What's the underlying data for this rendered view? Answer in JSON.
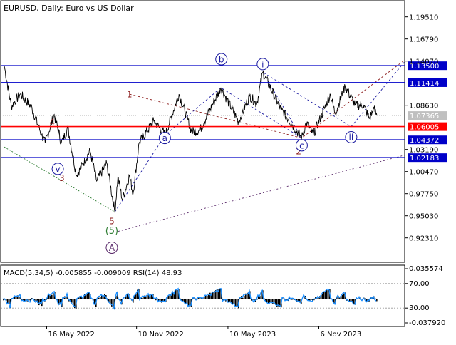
{
  "header": {
    "symbol_title": "EURUSD, Daily:  Euro vs US Dollar"
  },
  "indicator": {
    "title": "MACD(5,34,5) -0.005855 -0.009009 RSI(14) 48.93",
    "axis_labels": [
      "0.035574",
      "70.00",
      "30.00",
      "-0.037920"
    ]
  },
  "colors": {
    "level_blue": "#0000c8",
    "level_red": "#ff0000",
    "price_line": "#000000",
    "wave_red": "#8b1a1a",
    "wave_blue": "#1a1aa0",
    "wave_green": "#2e7d32",
    "wave_purple": "#5a2a6a",
    "rsi_line": "#1e90ff",
    "current_price_tag": "#c0c0c0"
  },
  "price_axis_labels": [
    "1.19510",
    "1.16790",
    "1.14070",
    "1.08630",
    "1.03190",
    "1.00470",
    "0.97750",
    "0.95030",
    "0.92310"
  ],
  "level_tags": [
    {
      "value": 1.135,
      "label": "1.13500",
      "type": "blue"
    },
    {
      "value": 1.11414,
      "label": "1.11414",
      "type": "blue"
    },
    {
      "value": 1.07365,
      "label": "1.07365",
      "type": "current"
    },
    {
      "value": 1.06005,
      "label": "1.06005",
      "type": "red"
    },
    {
      "value": 1.04372,
      "label": "1.04372",
      "type": "blue"
    },
    {
      "value": 1.02183,
      "label": "1.02183",
      "type": "blue"
    }
  ],
  "time_axis_labels": [
    "16 May 2022",
    "10 Nov 2022",
    "10 May 2023",
    "6 Nov 2023"
  ],
  "wave_labels": [
    {
      "text": "1",
      "style": "red-plain",
      "date": "2022-10-27",
      "price": 1.1
    },
    {
      "text": "2",
      "style": "red-plain",
      "date": "2023-09-27",
      "price": 1.03
    },
    {
      "text": "3",
      "style": "red-plain",
      "date": "2022-06-15",
      "price": 0.997
    },
    {
      "text": "4",
      "style": "red-plain",
      "date": "2022-05-27",
      "price": 1.066
    },
    {
      "text": "5",
      "style": "red-plain",
      "date": "2022-09-22",
      "price": 0.944
    },
    {
      "text": "(5)",
      "style": "green",
      "date": "2022-09-22",
      "price": 0.932
    },
    {
      "text": "A",
      "style": "purple-circle",
      "date": "2022-09-22",
      "price": 0.911
    },
    {
      "text": "a",
      "style": "blue-circle",
      "date": "2023-01-05",
      "price": 1.046
    },
    {
      "text": "b",
      "style": "blue-circle",
      "date": "2023-04-27",
      "price": 1.143
    },
    {
      "text": "c",
      "style": "blue-circle",
      "date": "2023-10-03",
      "price": 1.037
    },
    {
      "text": "v",
      "style": "blue-circle",
      "date": "2022-06-07",
      "price": 1.008
    },
    {
      "text": "i",
      "style": "blue-circle",
      "date": "2023-07-18",
      "price": 1.137
    },
    {
      "text": "ii",
      "style": "blue-circle",
      "date": "2024-01-09",
      "price": 1.047
    }
  ],
  "chart_data": {
    "type": "line",
    "symbol": "EURUSD",
    "timeframe": "Daily",
    "x_axis": "date",
    "price_series": [
      {
        "date": "2022-02-21",
        "price": 1.135
      },
      {
        "date": "2022-03-07",
        "price": 1.085
      },
      {
        "date": "2022-03-25",
        "price": 1.1
      },
      {
        "date": "2022-04-15",
        "price": 1.085
      },
      {
        "date": "2022-05-06",
        "price": 1.05
      },
      {
        "date": "2022-05-13",
        "price": 1.04
      },
      {
        "date": "2022-05-31",
        "price": 1.075
      },
      {
        "date": "2022-06-14",
        "price": 1.04
      },
      {
        "date": "2022-06-27",
        "price": 1.058
      },
      {
        "date": "2022-07-14",
        "price": 1.0
      },
      {
        "date": "2022-08-10",
        "price": 1.03
      },
      {
        "date": "2022-08-23",
        "price": 0.993
      },
      {
        "date": "2022-09-12",
        "price": 1.015
      },
      {
        "date": "2022-09-28",
        "price": 0.955
      },
      {
        "date": "2022-10-04",
        "price": 0.998
      },
      {
        "date": "2022-10-13",
        "price": 0.97
      },
      {
        "date": "2022-10-27",
        "price": 1.0
      },
      {
        "date": "2022-11-03",
        "price": 0.977
      },
      {
        "date": "2022-11-15",
        "price": 1.04
      },
      {
        "date": "2022-12-14",
        "price": 1.067
      },
      {
        "date": "2023-01-06",
        "price": 1.05
      },
      {
        "date": "2023-02-02",
        "price": 1.1
      },
      {
        "date": "2023-02-27",
        "price": 1.054
      },
      {
        "date": "2023-03-15",
        "price": 1.055
      },
      {
        "date": "2023-04-26",
        "price": 1.108
      },
      {
        "date": "2023-05-31",
        "price": 1.066
      },
      {
        "date": "2023-06-22",
        "price": 1.098
      },
      {
        "date": "2023-07-06",
        "price": 1.088
      },
      {
        "date": "2023-07-18",
        "price": 1.127
      },
      {
        "date": "2023-08-24",
        "price": 1.08
      },
      {
        "date": "2023-09-07",
        "price": 1.069
      },
      {
        "date": "2023-10-03",
        "price": 1.046
      },
      {
        "date": "2023-10-12",
        "price": 1.065
      },
      {
        "date": "2023-10-26",
        "price": 1.05
      },
      {
        "date": "2023-11-29",
        "price": 1.1
      },
      {
        "date": "2023-12-08",
        "price": 1.076
      },
      {
        "date": "2023-12-28",
        "price": 1.11
      },
      {
        "date": "2024-01-17",
        "price": 1.086
      },
      {
        "date": "2024-02-02",
        "price": 1.087
      },
      {
        "date": "2024-02-14",
        "price": 1.07
      },
      {
        "date": "2024-02-23",
        "price": 1.082
      },
      {
        "date": "2024-02-29",
        "price": 1.07365
      }
    ],
    "horizontal_levels": [
      1.135,
      1.11414,
      1.06005,
      1.04372,
      1.02183
    ],
    "current_price": 1.07365,
    "y_ticks": [
      1.1951,
      1.1679,
      1.1407,
      1.0863,
      1.0319,
      1.0047,
      0.9775,
      0.9503,
      0.9231
    ],
    "ylim": [
      0.893,
      1.215
    ],
    "xlim": [
      "2022-02-14",
      "2024-04-24"
    ],
    "x_ticks": [
      "2022-05-16",
      "2022-11-10",
      "2023-05-10",
      "2023-11-06"
    ],
    "trend_lines": [
      {
        "name": "blue wave path",
        "style": "dashed",
        "points": [
          [
            "2022-09-28",
            0.955
          ],
          [
            "2023-01-06",
            1.05
          ],
          [
            "2023-04-26",
            1.108
          ],
          [
            "2023-10-03",
            1.046
          ],
          [
            "2023-07-18",
            1.127
          ],
          [
            "2024-01-09",
            1.06
          ],
          [
            "2024-04-24",
            1.14
          ]
        ]
      },
      {
        "name": "red channel upper",
        "style": "dashed",
        "points": [
          [
            "2022-10-27",
            1.1
          ],
          [
            "2023-10-03",
            1.046
          ],
          [
            "2024-04-24",
            1.142
          ]
        ]
      },
      {
        "name": "purple support",
        "style": "dashed",
        "points": [
          [
            "2022-09-28",
            0.93
          ],
          [
            "2024-04-24",
            1.025
          ]
        ]
      },
      {
        "name": "green wave path",
        "style": "dashed",
        "points": [
          [
            "2022-02-21",
            1.035
          ],
          [
            "2022-09-28",
            0.955
          ]
        ]
      }
    ],
    "indicator_panel": {
      "macd_fast": 5,
      "macd_slow": 34,
      "macd_signal": 5,
      "rsi_period": 14,
      "macd_value": -0.005855,
      "macd_signal_value": -0.009009,
      "rsi_value": 48.93,
      "ylim": [
        -0.03792,
        0.035574
      ],
      "rsi_levels": [
        70,
        30
      ]
    }
  }
}
